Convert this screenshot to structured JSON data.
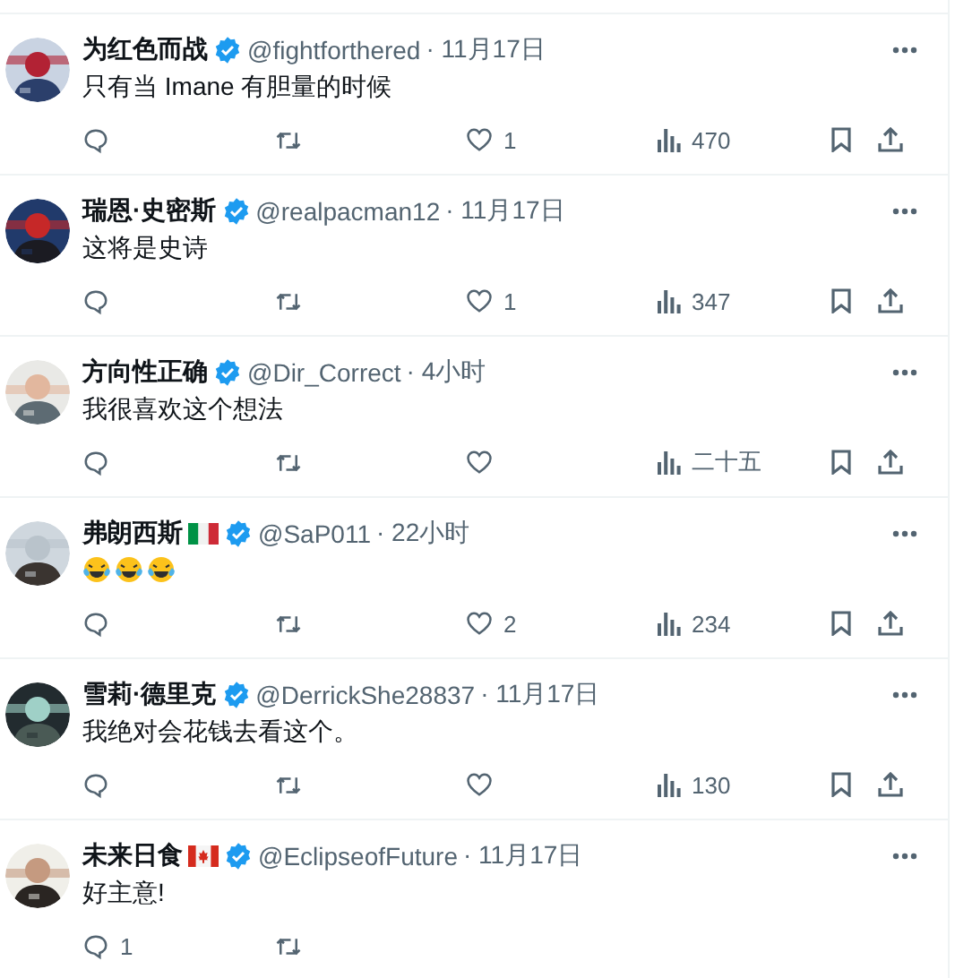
{
  "replies": [
    {
      "name": "为红色而战",
      "verified": true,
      "handle": "@fightforthered",
      "time": "· 11月17日",
      "text": "只有当 Imane 有胆量的时候",
      "likes": "1",
      "views": "470"
    },
    {
      "name": "瑞恩·史密斯",
      "verified": true,
      "handle": "@realpacman12",
      "time": "· 11月17日",
      "text": "这将是史诗",
      "likes": "1",
      "views": "347"
    },
    {
      "name": "方向性正确",
      "verified": true,
      "handle": "@Dir_Correct",
      "time": "· 4小时",
      "text": "我很喜欢这个想法",
      "views": "二十五"
    },
    {
      "name": "弗朗西斯",
      "flag": {
        "kind": "italy"
      },
      "verified": true,
      "handle": "@SaP011",
      "time": "· 22小时",
      "body_icons": [
        {
          "kind": "tears-of-joy"
        },
        {
          "kind": "tears-of-joy"
        },
        {
          "kind": "tears-of-joy"
        }
      ],
      "likes": "2",
      "views": "234"
    },
    {
      "name": "雪莉·德里克",
      "verified": true,
      "handle": "@DerrickShe28837",
      "time": "· 11月17日",
      "text": "我绝对会花钱去看这个。",
      "views": "130"
    },
    {
      "name": "未来日食",
      "flag": {
        "kind": "canada"
      },
      "verified": true,
      "handle": "@EclipseofFuture",
      "time": "· 11月17日",
      "text": "好主意!",
      "replies": "1"
    }
  ]
}
